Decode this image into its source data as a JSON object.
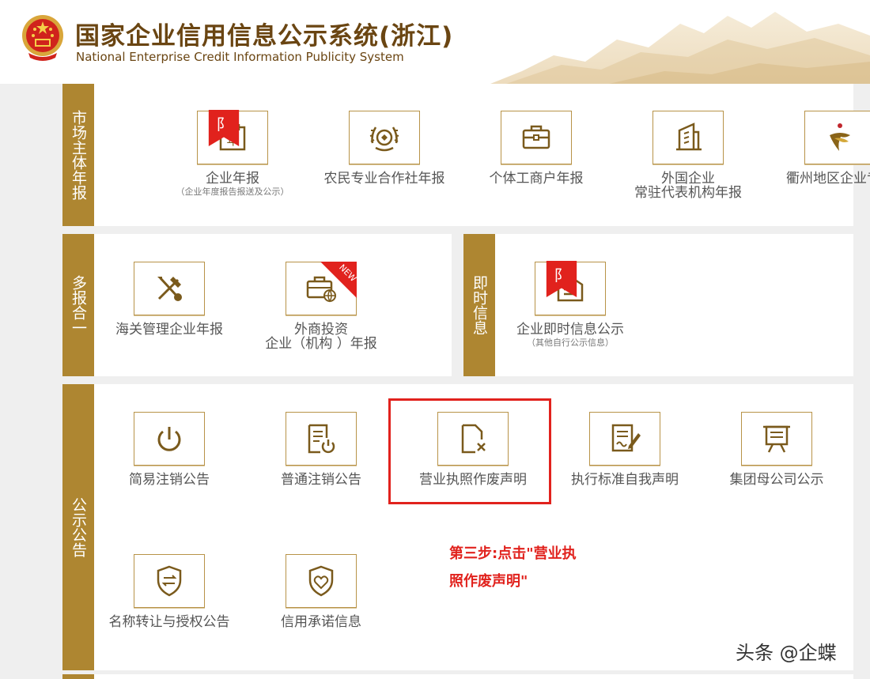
{
  "header": {
    "title_cn": "国家企业信用信息公示系统(浙江)",
    "title_en": "National Enterprise Credit Information Publicity System"
  },
  "sections": {
    "market": {
      "label": "市场主体年报",
      "items": [
        {
          "label": "企业年报",
          "sub": "（企业年度报告报送及公示）",
          "icon": "calendar-year-icon"
        },
        {
          "label": "农民专业合作社年报",
          "icon": "wheat-emblem-icon"
        },
        {
          "label": "个体工商户年报",
          "icon": "briefcase-icon"
        },
        {
          "label": "外国企业",
          "label2": "常驻代表机构年报",
          "icon": "building-icon"
        },
        {
          "label": "衢州地区企业专报",
          "icon": "quzhou-logo-icon"
        }
      ]
    },
    "multi": {
      "label": "多报合一",
      "items": [
        {
          "label": "海关管理企业年报",
          "icon": "tools-icon"
        },
        {
          "label": "外商投资",
          "label2": "企业（机构 ）年报",
          "icon": "briefcase-globe-icon",
          "badge": "NEW"
        }
      ]
    },
    "instant": {
      "label": "即时信息",
      "items": [
        {
          "label": "企业即时信息公示",
          "sub": "（其他自行公示信息）",
          "icon": "document-tray-icon"
        }
      ]
    },
    "notice": {
      "label": "公示公告",
      "items": [
        {
          "label": "简易注销公告",
          "icon": "power-icon"
        },
        {
          "label": "普通注销公告",
          "icon": "document-power-icon"
        },
        {
          "label": "营业执照作废声明",
          "icon": "document-x-icon"
        },
        {
          "label": "执行标准自我声明",
          "icon": "document-pen-icon"
        },
        {
          "label": "集团母公司公示",
          "icon": "board-icon"
        },
        {
          "label": "名称转让与授权公告",
          "icon": "shield-transfer-icon"
        },
        {
          "label": "信用承诺信息",
          "icon": "shield-heart-icon"
        }
      ]
    }
  },
  "tag_char": "阝",
  "annotation": {
    "line1": "第三步:点击\"营业执",
    "line2": "照作废声明\""
  },
  "watermark": "头条 @企蝶",
  "colors": {
    "gold": "#ae8631",
    "brown": "#6a4512",
    "highlight": "#e1221d"
  }
}
